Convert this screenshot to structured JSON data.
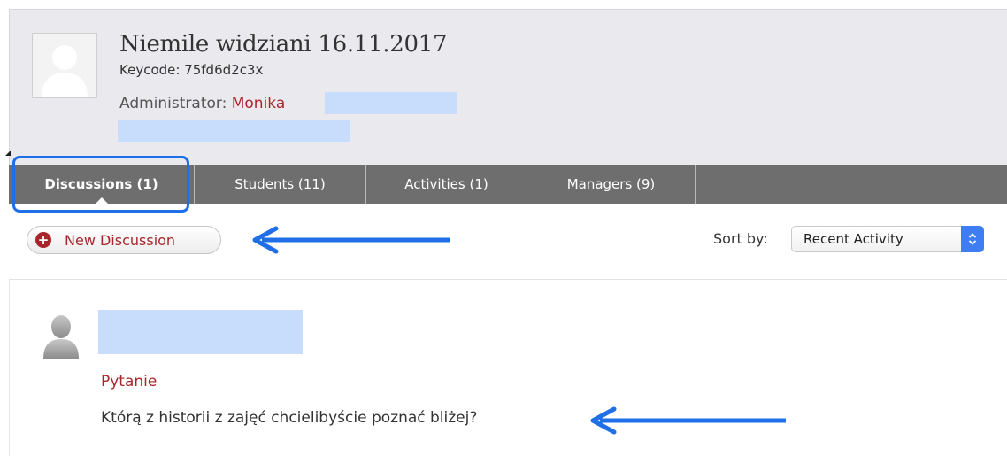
{
  "group": {
    "title": "Niemile widziani 16.11.2017",
    "keycode": "Keycode: 75fd6d2c3x",
    "admin_label": "Administrator:",
    "admin_name": "Monika"
  },
  "tabs": [
    {
      "label": "Discussions (1)",
      "active": true
    },
    {
      "label": "Students (11)",
      "active": false
    },
    {
      "label": "Activities (1)",
      "active": false
    },
    {
      "label": "Managers (9)",
      "active": false
    }
  ],
  "toolbar": {
    "new_discussion_label": "New Discussion",
    "sort_label": "Sort by:",
    "sort_value": "Recent Activity"
  },
  "discussion": {
    "title": "Pytanie",
    "body": "Którą z historii z zajęć chcielibyście poznać bliżej?"
  },
  "colors": {
    "accent": "#a8262b",
    "tab_bar": "#6e6e6e",
    "annotation_blue": "#1f6fe8",
    "redaction": "#c8dcfb",
    "select_button": "#3e7ef2"
  },
  "icons": {
    "group_avatar": "person-placeholder-icon",
    "new_discussion": "plus-circle-icon",
    "sort": "chevron-updown-icon",
    "poster": "user-silhouette-icon"
  }
}
